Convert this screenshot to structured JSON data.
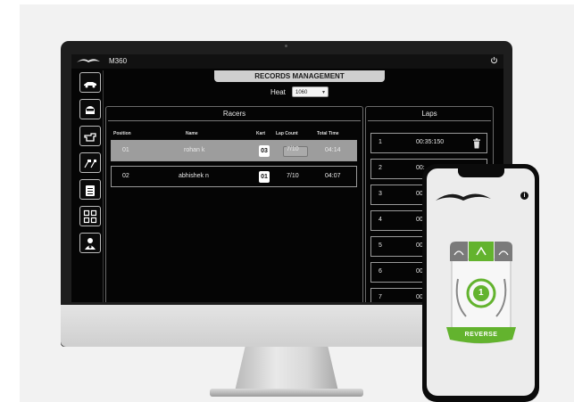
{
  "app": {
    "title": "M360"
  },
  "header": {
    "title": "RECORDS MANAGEMENT"
  },
  "heat": {
    "label": "Heat",
    "value": "1060"
  },
  "racers": {
    "title": "Racers",
    "columns": [
      "Position",
      "Name",
      "Kart",
      "Lap Count",
      "Total Time"
    ],
    "rows": [
      {
        "position": "01",
        "name": "rohan k",
        "kart": "03",
        "lap_count": "7/10",
        "total_time": "04:14",
        "selected": true
      },
      {
        "position": "02",
        "name": "abhishek n",
        "kart": "01",
        "lap_count": "7/10",
        "total_time": "04:07",
        "selected": false
      }
    ]
  },
  "laps": {
    "title": "Laps",
    "rows": [
      {
        "num": "1",
        "time": "00:35:150"
      },
      {
        "num": "2",
        "time": "00:"
      },
      {
        "num": "3",
        "time": "00"
      },
      {
        "num": "4",
        "time": "00"
      },
      {
        "num": "5",
        "time": "00"
      },
      {
        "num": "6",
        "time": "00:"
      },
      {
        "num": "7",
        "time": "00"
      }
    ]
  },
  "sidebar": {
    "items": [
      "kart-icon",
      "helmet-icon",
      "hand-pointer-icon",
      "race-flags-icon",
      "clipboard-icon",
      "grid-icon",
      "driver-settings-icon"
    ]
  },
  "phone": {
    "device_number": "1",
    "mode_label": "REVERSE",
    "accent": "#63b32e"
  },
  "colors": {
    "accent_green": "#63b32e",
    "screen_bg": "#050505",
    "selected_row": "#9d9d9d"
  }
}
